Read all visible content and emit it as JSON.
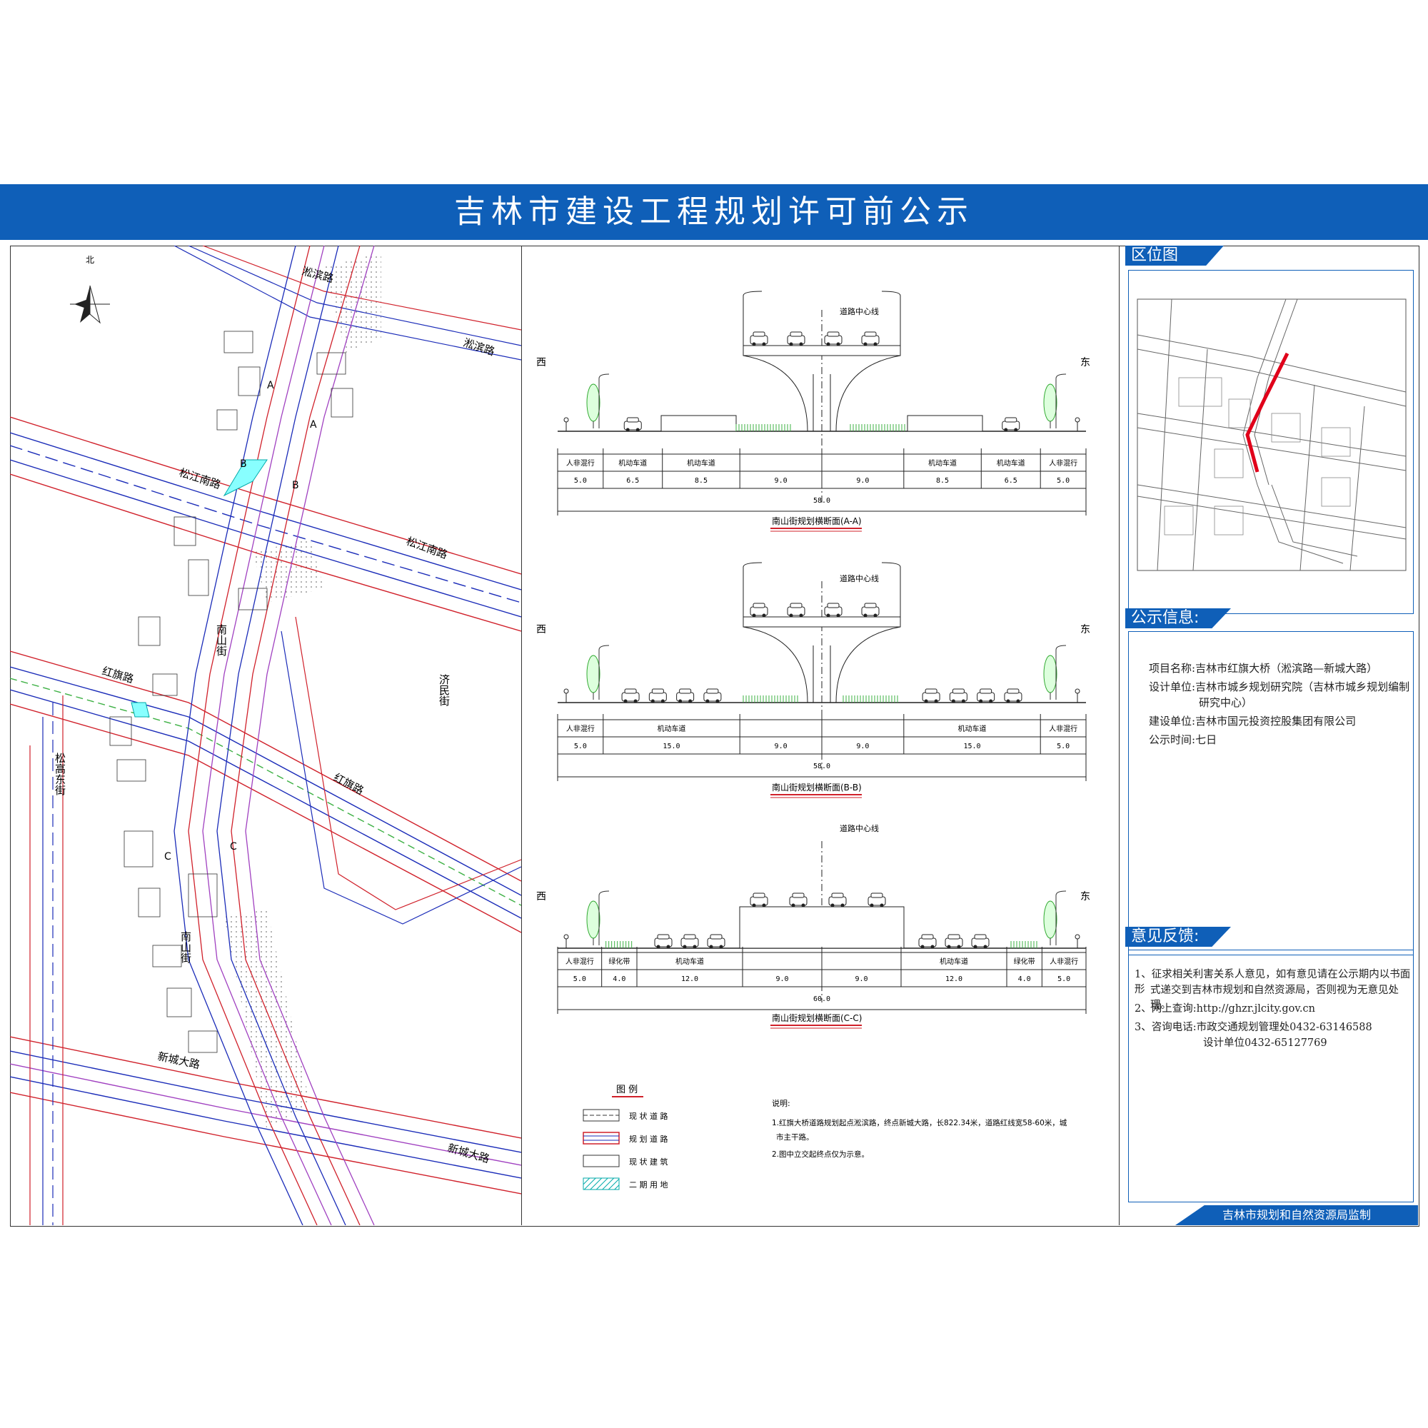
{
  "title": "吉林市建设工程规划许可前公示",
  "map": {
    "north": "北",
    "roads": {
      "songbin1": "淞滨路",
      "songbin2": "淞滨路",
      "songjiang1": "松江南路",
      "songjiang2": "松江南路",
      "hongqi1": "红旗路",
      "hongqi2": "红旗路",
      "nanshan1": "南山街",
      "nanshan2": "南山街",
      "songgao": "松高东街",
      "jimin": "济民街",
      "xincheng1": "新城大路",
      "xincheng2": "新城大路"
    },
    "markers": [
      "A",
      "A",
      "B",
      "B",
      "C",
      "C"
    ]
  },
  "sections": [
    {
      "caption": "南山街规划横断面(A-A)",
      "centerline": "道路中心线",
      "west": "西",
      "east": "东",
      "labels": [
        "人非混行",
        "机动车道",
        "机动车道",
        "",
        "",
        "机动车道",
        "机动车道",
        "人非混行"
      ],
      "widths": [
        5.0,
        6.5,
        8.5,
        9.0,
        9.0,
        8.5,
        6.5,
        5.0
      ],
      "width_labels": [
        "5.0",
        "6.5",
        "8.5",
        "9.0",
        "9.0",
        "8.5",
        "6.5",
        "5.0"
      ],
      "total": "58.0",
      "elevated": true
    },
    {
      "caption": "南山街规划横断面(B-B)",
      "centerline": "道路中心线",
      "west": "西",
      "east": "东",
      "labels": [
        "人非混行",
        "机动车道",
        "",
        "",
        "机动车道",
        "人非混行"
      ],
      "widths": [
        5.0,
        15.0,
        9.0,
        9.0,
        15.0,
        5.0
      ],
      "width_labels": [
        "5.0",
        "15.0",
        "9.0",
        "9.0",
        "15.0",
        "5.0"
      ],
      "total": "58.0",
      "elevated": true
    },
    {
      "caption": "南山街规划横断面(C-C)",
      "centerline": "道路中心线",
      "west": "西",
      "east": "东",
      "labels": [
        "人非混行",
        "绿化带",
        "机动车道",
        "",
        "",
        "机动车道",
        "绿化带",
        "人非混行"
      ],
      "widths": [
        5.0,
        4.0,
        12.0,
        9.0,
        9.0,
        12.0,
        4.0,
        5.0
      ],
      "width_labels": [
        "5.0",
        "4.0",
        "12.0",
        "9.0",
        "9.0",
        "12.0",
        "4.0",
        "5.0"
      ],
      "total": "60.0",
      "elevated": false
    }
  ],
  "legend": {
    "title": "图  例",
    "items": [
      "现 状 道 路",
      "规 划 道 路",
      "现 状 建 筑",
      "二 期 用 地"
    ]
  },
  "notes": {
    "title": "说明:",
    "lines": [
      "1.红旗大桥道路规划起点淞滨路，终点新城大路，长822.34米，道路红线宽58-60米，城",
      "市主干路。",
      "2.图中立交起终点仅为示意。"
    ]
  },
  "location": {
    "header": "区位图"
  },
  "info": {
    "header": "公示信息:",
    "project_label": "项目名称:",
    "project_value": "吉林市红旗大桥（淞滨路—新城大路）",
    "design_label": "设计单位:",
    "design_value_1": "吉林市城乡规划研究院（吉林市城乡规划编制",
    "design_value_2": "研究中心）",
    "builder_label": "建设单位:",
    "builder_value": "吉林市国元投资控股集团有限公司",
    "period_label": "公示时间:",
    "period_value": "七日"
  },
  "feedback": {
    "header": "意见反馈:",
    "item1_a": "1、征求相关利害关系人意见，如有意见请在公示期内以书面形",
    "item1_b": "式递交到吉林市规划和自然资源局，否则视为无意见处理。",
    "item2_label": "2、网上查询:",
    "item2_value": "http://ghzr.jlcity.gov.cn",
    "item3_label": "3、咨询电话:",
    "item3_value_1": "市政交通规划管理处0432-63146588",
    "item3_value_2": "设计单位0432-65127769"
  },
  "footer": "吉林市规划和自然资源局监制",
  "colors": {
    "brand_blue": "#0f5fb8",
    "plan_red": "#d0202a",
    "road_blue": "#1a2bb8",
    "purple": "#a040c0",
    "green": "#3cb043"
  }
}
